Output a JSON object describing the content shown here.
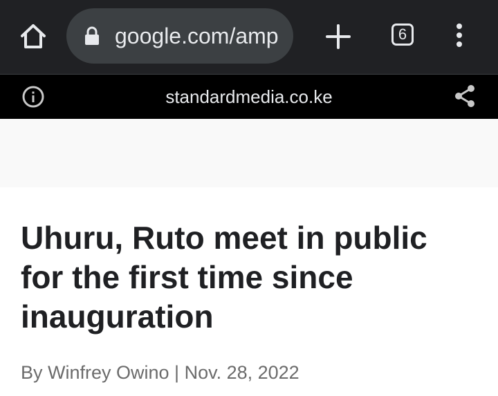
{
  "browser": {
    "url": "google.com/amp",
    "tab_count": "6",
    "icons": {
      "home": "home-icon",
      "lock": "lock-icon",
      "new_tab": "plus-icon",
      "menu": "more-vert-icon"
    }
  },
  "amp_bar": {
    "origin": "standardmedia.co.ke",
    "icons": {
      "info": "info-icon",
      "share": "share-icon"
    }
  },
  "article": {
    "headline": "Uhuru, Ruto meet in public for the first time since inauguration",
    "byline": "By Winfrey Owino | Nov. 28, 2022"
  },
  "colors": {
    "toolbar_bg": "#202124",
    "omnibox_bg": "#3c4043",
    "amp_bar_bg": "#000000",
    "headline_text": "#1f2023",
    "byline_text": "#6b6b6b"
  }
}
